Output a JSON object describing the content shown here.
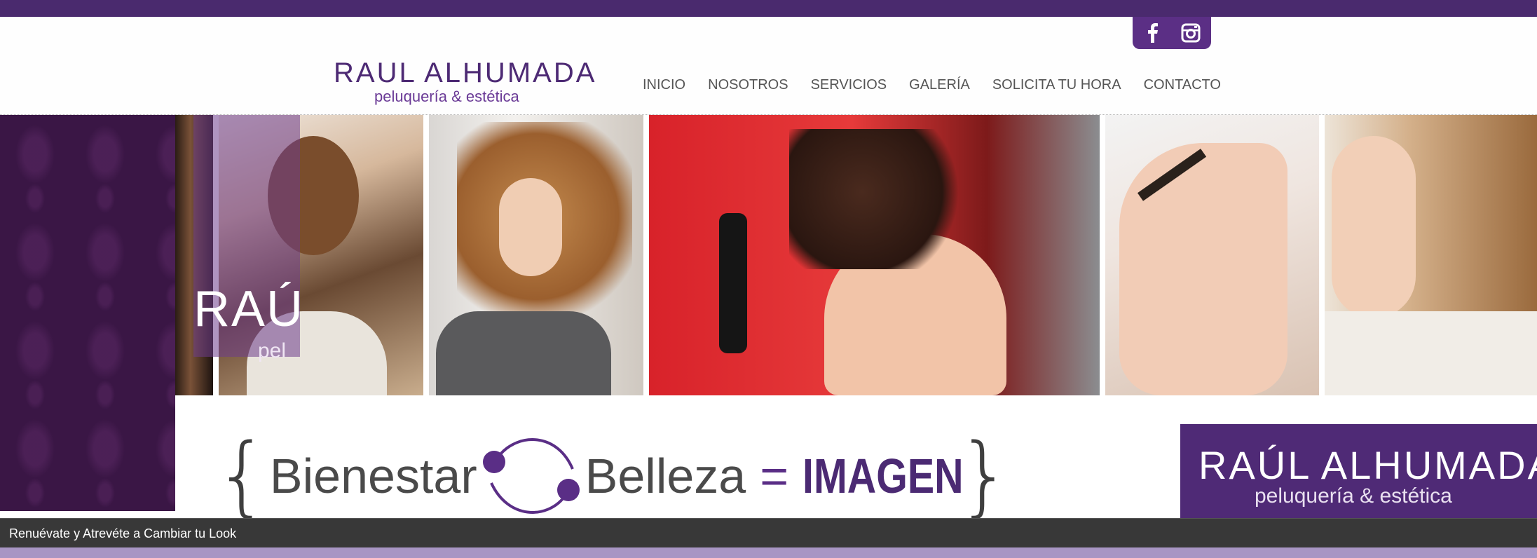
{
  "header": {
    "logo_line1": "RAUL ALHUMADA",
    "logo_line2": "peluquería & estética",
    "nav": [
      "INICIO",
      "NOSOTROS",
      "SERVICIOS",
      "GALERÍA",
      "SOLICITA TU HORA",
      "CONTACTO"
    ],
    "social": [
      {
        "name": "facebook-icon",
        "glyph": "f"
      },
      {
        "name": "instagram-icon",
        "glyph": "◙"
      }
    ]
  },
  "hero": {
    "overlay_text": "RAÚ",
    "overlay_sub": "pel",
    "slogan": {
      "open_brace": "{",
      "word1": "Bienestar",
      "word2": "Belleza",
      "equals": "=",
      "result": "IMAGEN",
      "close_brace": "}"
    },
    "brand_box": {
      "line1": "RAÚL ALHUMADA",
      "line2": "peluquería & estética"
    }
  },
  "tagline": "Renuévate y Atrevéte a Cambiar tu Look",
  "colors": {
    "brand_purple": "#4f2a76",
    "top_bar": "#4a2a6e",
    "tagline_bar": "#383838"
  }
}
